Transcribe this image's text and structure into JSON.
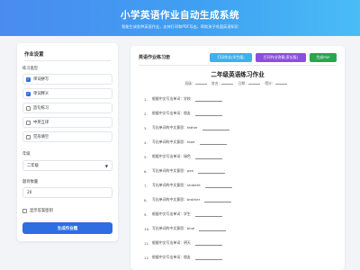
{
  "header": {
    "title": "小学英语作业自动生成系统",
    "subtitle": "智能生成各种英语作业，支持打印和PDF导出，帮助孩子巩固英语知识"
  },
  "settings": {
    "title": "作业设置",
    "types_label": "练习类型",
    "types": [
      {
        "label": "单词拼写",
        "checked": true
      },
      {
        "label": "单词释义",
        "checked": true
      },
      {
        "label": "造句练习",
        "checked": false
      },
      {
        "label": "中英互译",
        "checked": false
      },
      {
        "label": "完形填空",
        "checked": false
      }
    ],
    "grade_label": "年级",
    "grade_value": "二年级",
    "count_label": "题目数量",
    "count_value": "20",
    "show_answers_label": "显示答案密钥",
    "show_answers_checked": false,
    "generate_label": "生成作业题"
  },
  "preview": {
    "title": "英语作业练习册",
    "buttons": {
      "print_student": "打印作业(学生版)",
      "print_teacher": "打印作业答案(家长版)",
      "pdf": "生成PDF"
    },
    "colors": {
      "print_student": "#3db0ef",
      "print_teacher": "#8a4fe0",
      "pdf": "#27a653"
    },
    "sheet_title": "二年级英语练习作业",
    "meta": {
      "class": "班级：",
      "name": "姓名：",
      "date": "日期：",
      "score": "得分："
    },
    "questions": [
      {
        "num": "1.",
        "text": "根据中文写出单词：学校"
      },
      {
        "num": "2.",
        "text": "根据中文写出单词：朋友"
      },
      {
        "num": "3.",
        "text": "写出单词的中文意思：father"
      },
      {
        "num": "4.",
        "text": "写出单词的中文意思：food"
      },
      {
        "num": "5.",
        "text": "根据中文写出单词：绿色"
      },
      {
        "num": "6.",
        "text": "写出单词的中文意思：pen"
      },
      {
        "num": "7.",
        "text": "写出单词的中文意思：student"
      },
      {
        "num": "8.",
        "text": "写出单词的中文意思：brother"
      },
      {
        "num": "9.",
        "text": "根据中文写出单词：学生"
      },
      {
        "num": "10.",
        "text": "写出单词的中文意思：blue"
      },
      {
        "num": "11.",
        "text": "根据中文写出单词：明天"
      },
      {
        "num": "12.",
        "text": "根据中文写出单词：朋友"
      }
    ]
  }
}
